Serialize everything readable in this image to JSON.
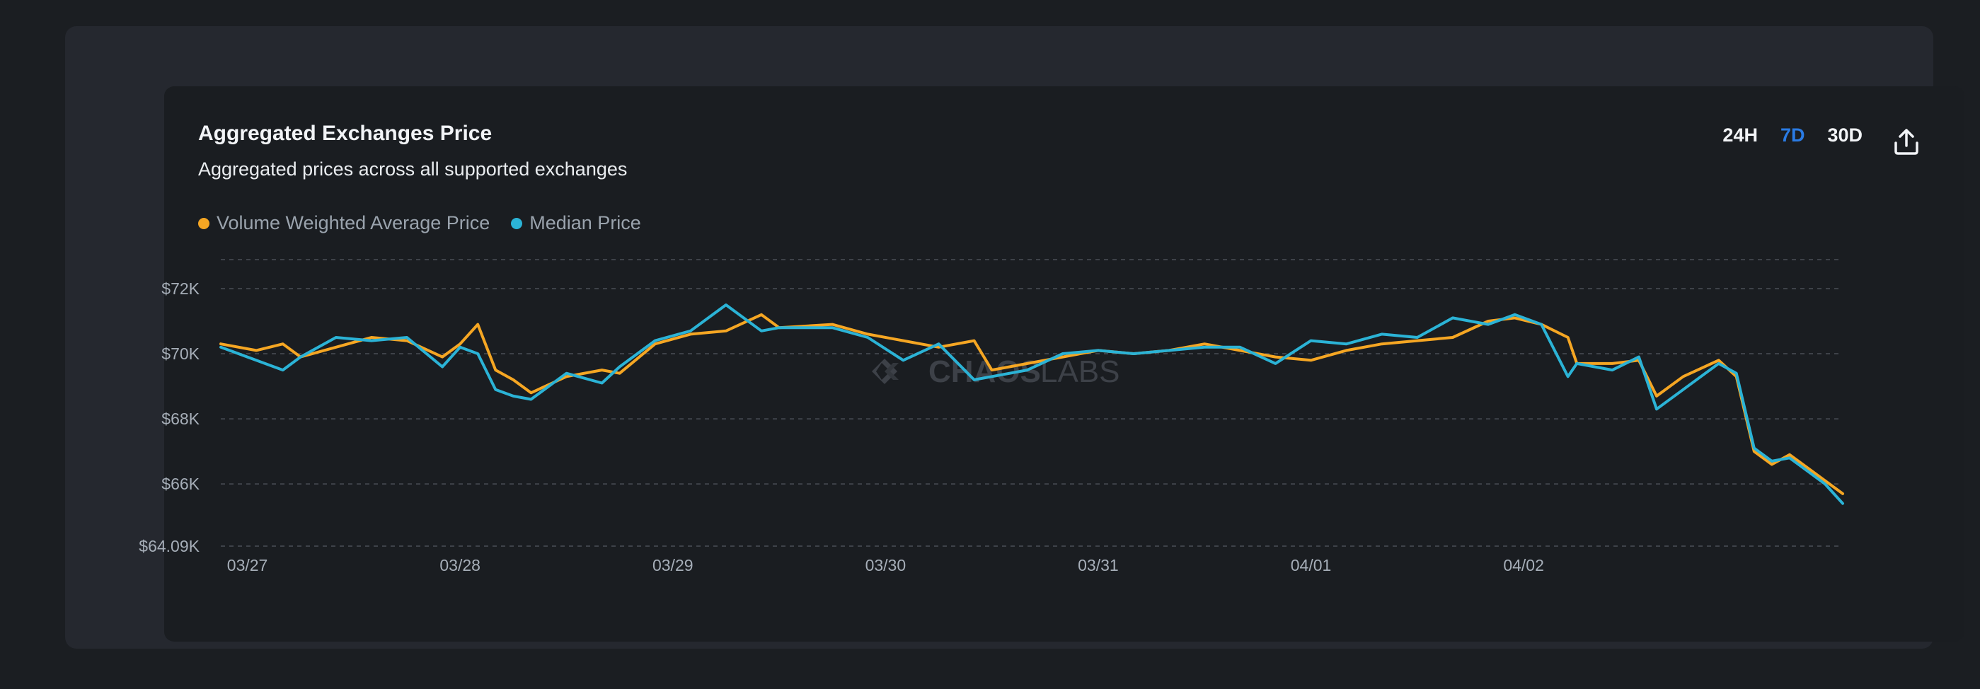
{
  "card": {
    "title": "Aggregated Exchanges Price",
    "subtitle": "Aggregated prices across all supported exchanges"
  },
  "time_ranges": [
    {
      "label": "24H",
      "active": false
    },
    {
      "label": "7D",
      "active": true
    },
    {
      "label": "30D",
      "active": false
    }
  ],
  "share_icon": "share-upload-icon",
  "watermark": {
    "bold": "CHAOS",
    "light": "LABS"
  },
  "colors": {
    "vwap": "#f5a623",
    "median": "#2bb3d6",
    "active_range": "#2a7be4"
  },
  "chart_data": {
    "type": "line",
    "title": "Aggregated Exchanges Price",
    "subtitle": "Aggregated prices across all supported exchanges",
    "ylim": [
      64090,
      73000
    ],
    "y_ticks": [
      {
        "value": 72000,
        "label": "$72K"
      },
      {
        "value": 70000,
        "label": "$70K"
      },
      {
        "value": 68000,
        "label": "$68K"
      },
      {
        "value": 66000,
        "label": "$66K"
      },
      {
        "value": 64090,
        "label": "$64.09K"
      }
    ],
    "x_range": [
      "03/26 21:00",
      "04/02 16:00"
    ],
    "x_ticks": [
      {
        "value": "03/27 00:00",
        "label": "03/27"
      },
      {
        "value": "03/28 00:00",
        "label": "03/28"
      },
      {
        "value": "03/29 00:00",
        "label": "03/29"
      },
      {
        "value": "03/30 00:00",
        "label": "03/30"
      },
      {
        "value": "03/31 00:00",
        "label": "03/31"
      },
      {
        "value": "04/01 00:00",
        "label": "04/01"
      },
      {
        "value": "04/02 00:00",
        "label": "04/02"
      }
    ],
    "grid": true,
    "legend_position": "top-left",
    "series": [
      {
        "name": "Volume Weighted Average Price",
        "color": "#f5a623",
        "points": [
          [
            "03/26 21:00",
            70300
          ],
          [
            "03/27 01:00",
            70100
          ],
          [
            "03/27 04:00",
            70300
          ],
          [
            "03/27 06:00",
            69900
          ],
          [
            "03/27 10:00",
            70200
          ],
          [
            "03/27 14:00",
            70500
          ],
          [
            "03/27 18:00",
            70400
          ],
          [
            "03/27 22:00",
            69900
          ],
          [
            "03/28 00:00",
            70300
          ],
          [
            "03/28 02:00",
            70900
          ],
          [
            "03/28 04:00",
            69500
          ],
          [
            "03/28 06:00",
            69200
          ],
          [
            "03/28 08:00",
            68800
          ],
          [
            "03/28 12:00",
            69300
          ],
          [
            "03/28 16:00",
            69500
          ],
          [
            "03/28 18:00",
            69400
          ],
          [
            "03/28 22:00",
            70300
          ],
          [
            "03/29 02:00",
            70600
          ],
          [
            "03/29 06:00",
            70700
          ],
          [
            "03/29 10:00",
            71200
          ],
          [
            "03/29 12:00",
            70800
          ],
          [
            "03/29 18:00",
            70900
          ],
          [
            "03/29 22:00",
            70600
          ],
          [
            "03/30 02:00",
            70400
          ],
          [
            "03/30 06:00",
            70200
          ],
          [
            "03/30 10:00",
            70400
          ],
          [
            "03/30 12:00",
            69500
          ],
          [
            "03/30 16:00",
            69700
          ],
          [
            "03/30 20:00",
            69900
          ],
          [
            "03/31 00:00",
            70100
          ],
          [
            "03/31 04:00",
            70000
          ],
          [
            "03/31 08:00",
            70100
          ],
          [
            "03/31 12:00",
            70300
          ],
          [
            "03/31 16:00",
            70100
          ],
          [
            "03/31 20:00",
            69900
          ],
          [
            "04/01 00:00",
            69800
          ],
          [
            "04/01 04:00",
            70100
          ],
          [
            "04/01 08:00",
            70300
          ],
          [
            "04/01 12:00",
            70400
          ],
          [
            "04/01 16:00",
            70500
          ],
          [
            "04/01 20:00",
            71000
          ],
          [
            "04/01 23:00",
            71100
          ],
          [
            "04/02 02:00",
            70900
          ],
          [
            "04/02 05:00",
            70500
          ],
          [
            "04/02 06:00",
            69700
          ],
          [
            "04/02 10:00",
            69700
          ],
          [
            "04/02 13:00",
            69800
          ],
          [
            "04/02 15:00",
            68700
          ],
          [
            "04/02 18:00",
            69300
          ],
          [
            "04/02 22:00",
            69800
          ],
          [
            "04/03 00:00",
            69300
          ],
          [
            "04/03 02:00",
            67000
          ],
          [
            "04/03 04:00",
            66600
          ],
          [
            "04/03 06:00",
            66900
          ],
          [
            "04/03 10:00",
            66100
          ],
          [
            "04/03 12:00",
            65700
          ]
        ]
      },
      {
        "name": "Median Price",
        "color": "#2bb3d6",
        "points": [
          [
            "03/26 21:00",
            70200
          ],
          [
            "03/27 01:00",
            69800
          ],
          [
            "03/27 04:00",
            69500
          ],
          [
            "03/27 06:00",
            69900
          ],
          [
            "03/27 10:00",
            70500
          ],
          [
            "03/27 14:00",
            70400
          ],
          [
            "03/27 18:00",
            70500
          ],
          [
            "03/27 22:00",
            69600
          ],
          [
            "03/28 00:00",
            70200
          ],
          [
            "03/28 02:00",
            70000
          ],
          [
            "03/28 04:00",
            68900
          ],
          [
            "03/28 06:00",
            68700
          ],
          [
            "03/28 08:00",
            68600
          ],
          [
            "03/28 12:00",
            69400
          ],
          [
            "03/28 16:00",
            69100
          ],
          [
            "03/28 18:00",
            69600
          ],
          [
            "03/28 22:00",
            70400
          ],
          [
            "03/29 02:00",
            70700
          ],
          [
            "03/29 06:00",
            71500
          ],
          [
            "03/29 10:00",
            70700
          ],
          [
            "03/29 12:00",
            70800
          ],
          [
            "03/29 18:00",
            70800
          ],
          [
            "03/29 22:00",
            70500
          ],
          [
            "03/30 02:00",
            69800
          ],
          [
            "03/30 06:00",
            70300
          ],
          [
            "03/30 10:00",
            69200
          ],
          [
            "03/30 12:00",
            69300
          ],
          [
            "03/30 16:00",
            69500
          ],
          [
            "03/30 20:00",
            70000
          ],
          [
            "03/31 00:00",
            70100
          ],
          [
            "03/31 04:00",
            70000
          ],
          [
            "03/31 08:00",
            70100
          ],
          [
            "03/31 12:00",
            70200
          ],
          [
            "03/31 16:00",
            70200
          ],
          [
            "03/31 20:00",
            69700
          ],
          [
            "04/01 00:00",
            70400
          ],
          [
            "04/01 04:00",
            70300
          ],
          [
            "04/01 08:00",
            70600
          ],
          [
            "04/01 12:00",
            70500
          ],
          [
            "04/01 16:00",
            71100
          ],
          [
            "04/01 20:00",
            70900
          ],
          [
            "04/01 23:00",
            71200
          ],
          [
            "04/02 02:00",
            70900
          ],
          [
            "04/02 05:00",
            69300
          ],
          [
            "04/02 06:00",
            69700
          ],
          [
            "04/02 10:00",
            69500
          ],
          [
            "04/02 13:00",
            69900
          ],
          [
            "04/02 15:00",
            68300
          ],
          [
            "04/02 18:00",
            68900
          ],
          [
            "04/02 22:00",
            69700
          ],
          [
            "04/03 00:00",
            69400
          ],
          [
            "04/03 02:00",
            67100
          ],
          [
            "04/03 04:00",
            66700
          ],
          [
            "04/03 06:00",
            66800
          ],
          [
            "04/03 10:00",
            66000
          ],
          [
            "04/03 12:00",
            65400
          ]
        ]
      }
    ]
  }
}
